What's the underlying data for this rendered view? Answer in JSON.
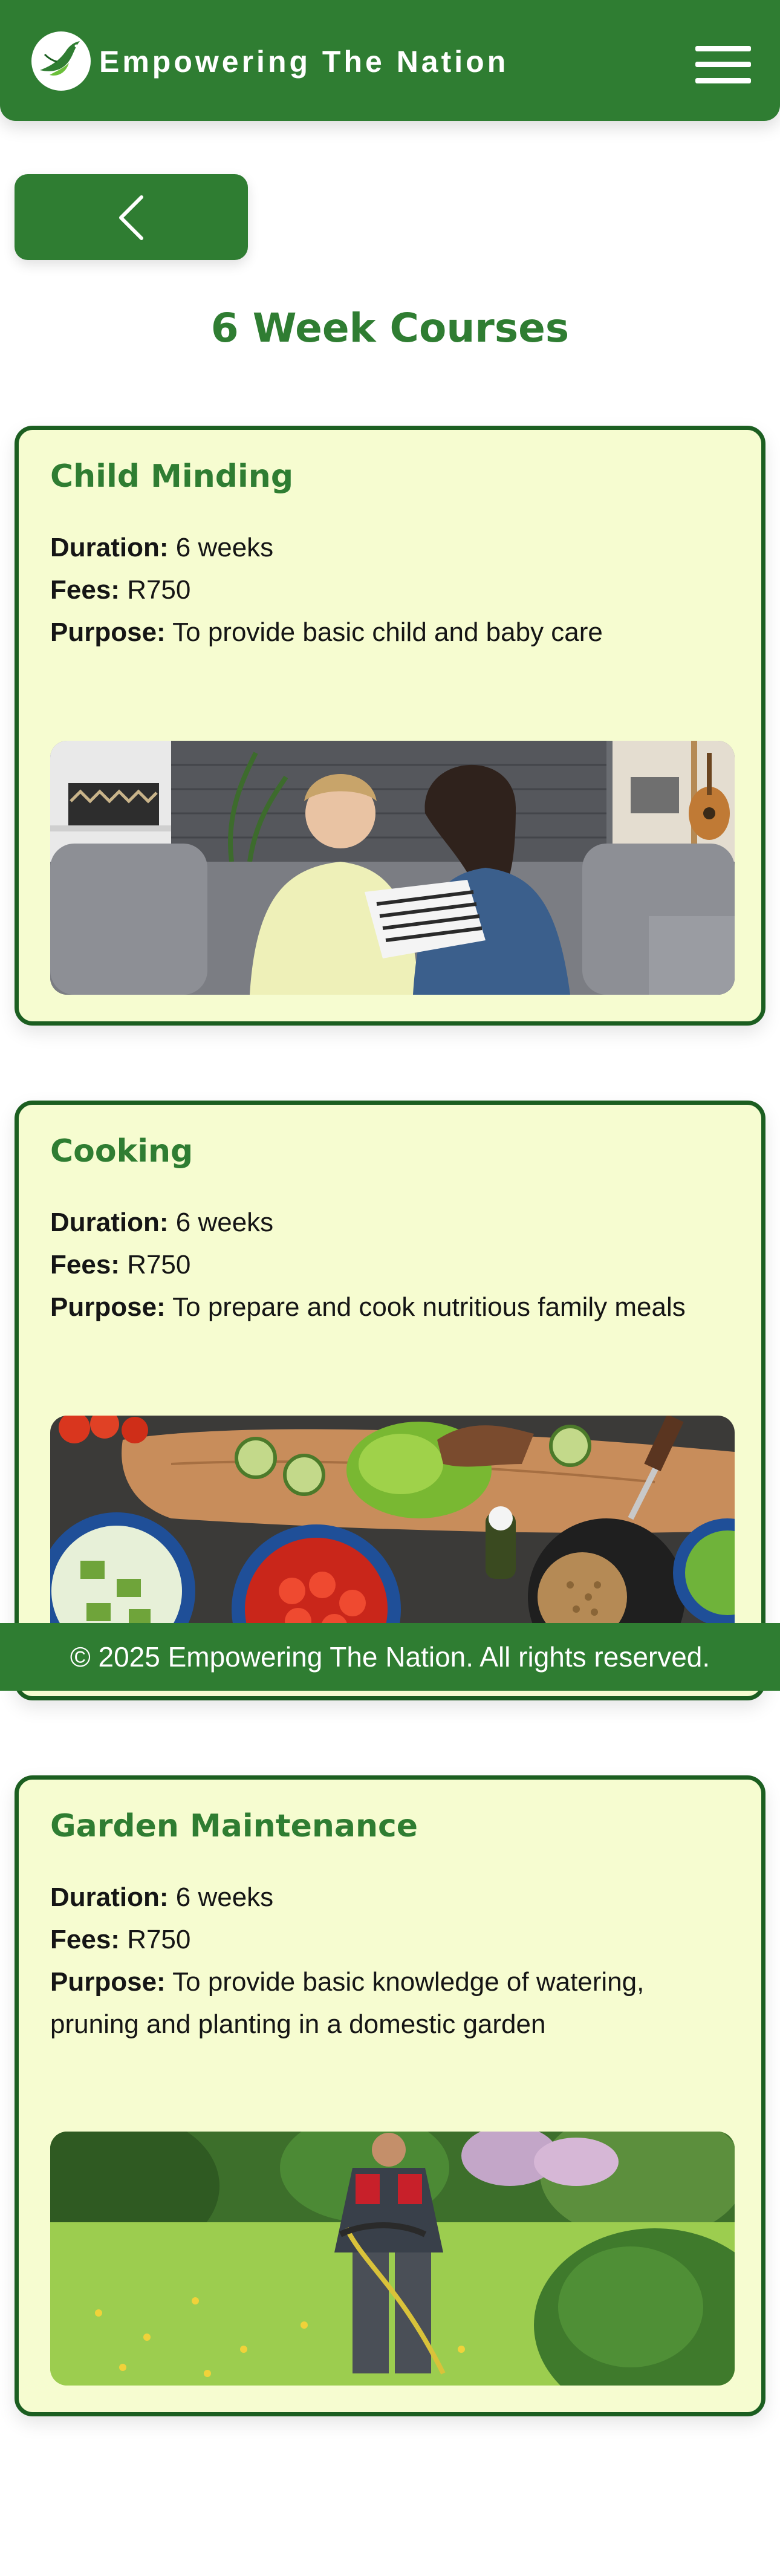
{
  "header": {
    "brand": "Empowering The Nation",
    "logo_icon": "dove-leaf-icon",
    "menu_icon": "hamburger-menu-icon",
    "colors": {
      "primary_green": "#2f7d32",
      "dark_green": "#1b5e20",
      "card_bg": "#f6fcd0"
    }
  },
  "nav": {
    "back_icon": "chevron-left-icon"
  },
  "page": {
    "title": "6 Week Courses"
  },
  "labels": {
    "duration": "Duration:",
    "fees": "Fees:",
    "purpose": "Purpose:"
  },
  "courses": [
    {
      "title": "Child Minding",
      "duration": "6 weeks",
      "fees": "R750",
      "purpose": "To provide basic child and baby care",
      "image": "mother-and-child-reading-photo"
    },
    {
      "title": "Cooking",
      "duration": "6 weeks",
      "fees": "R750",
      "purpose": "To prepare and cook nutritious family meals",
      "image": "vegetables-cooking-ingredients-photo"
    },
    {
      "title": "Garden Maintenance",
      "duration": "6 weeks",
      "fees": "R750",
      "purpose": "To provide basic knowledge of watering, pruning and planting in a domestic garden",
      "image": "gardener-trimming-grass-photo"
    }
  ],
  "footer": {
    "text": "© 2025 Empowering The Nation. All rights reserved."
  }
}
